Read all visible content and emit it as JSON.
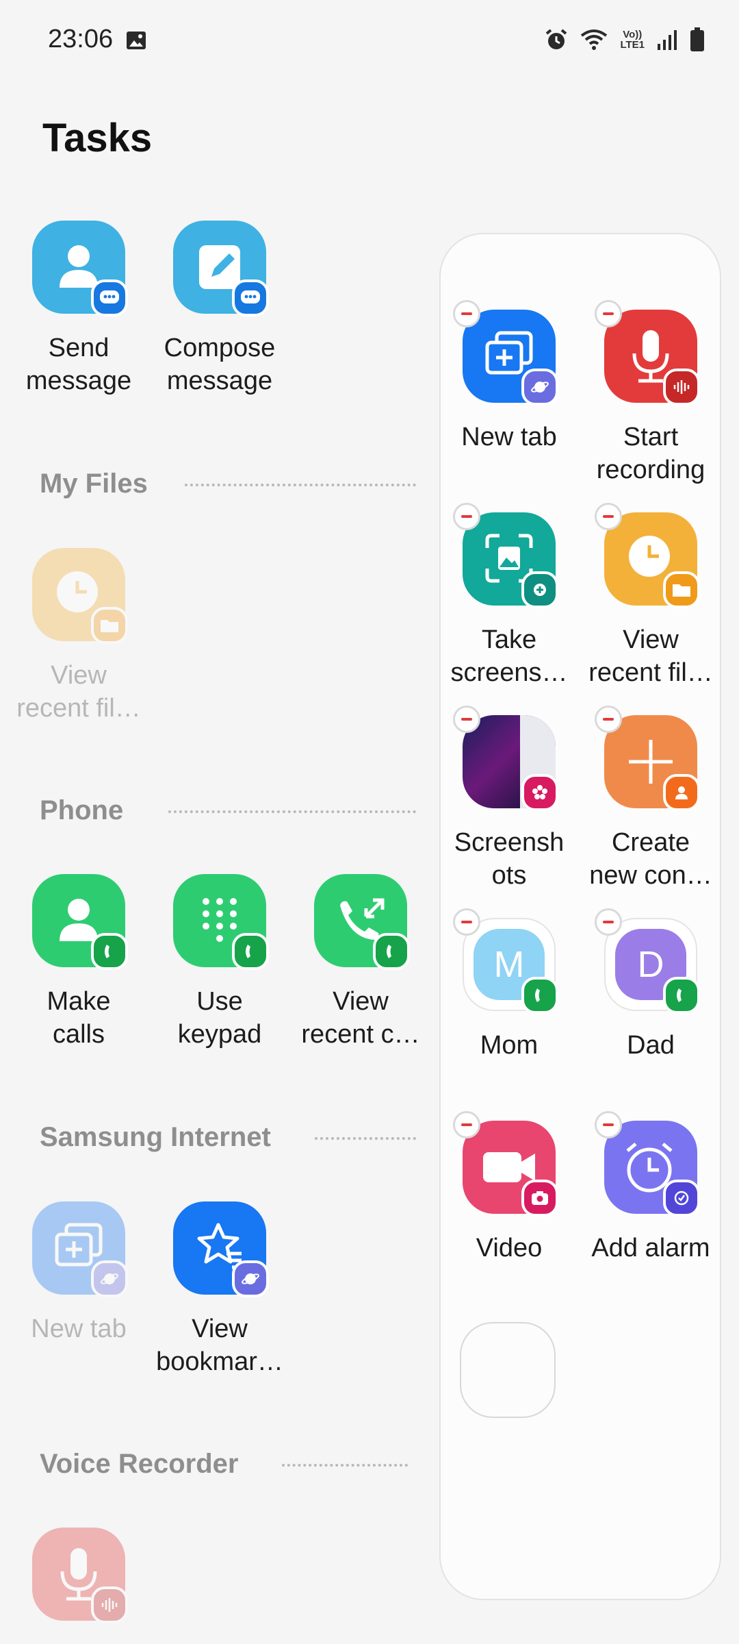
{
  "status_bar": {
    "time": "23:06",
    "network_label_top": "Vo))",
    "network_label_bottom": "LTE1",
    "icons": [
      "gallery-icon",
      "alarm-icon",
      "wifi-icon",
      "signal-icon",
      "battery-icon"
    ]
  },
  "page": {
    "title": "Tasks"
  },
  "sections": {
    "my_files": "My Files",
    "phone": "Phone",
    "samsung_internet": "Samsung Internet",
    "voice_recorder": "Voice Recorder"
  },
  "left": {
    "messages": [
      {
        "label": "Send\nmessage",
        "icon": "contact-icon"
      },
      {
        "label": "Compose\nmessage",
        "icon": "compose-icon"
      }
    ],
    "my_files": [
      {
        "label": "View\nrecent fil…",
        "icon": "clock-icon"
      }
    ],
    "phone": [
      {
        "label": "Make\ncalls",
        "icon": "contact-icon"
      },
      {
        "label": "Use\nkeypad",
        "icon": "keypad-icon"
      },
      {
        "label": "View\nrecent c…",
        "icon": "call-log-icon"
      }
    ],
    "samsung_internet": [
      {
        "label": "New tab",
        "icon": "new-tab-icon"
      },
      {
        "label": "View\nbookmar…",
        "icon": "bookmark-star-icon"
      }
    ],
    "voice_recorder": [
      {
        "label": "",
        "icon": "mic-icon"
      }
    ]
  },
  "panel": {
    "items": [
      {
        "label": "New tab"
      },
      {
        "label": "Start\nrecording"
      },
      {
        "label": "Take\nscreens…"
      },
      {
        "label": "View\nrecent fil…"
      },
      {
        "label": "Screensh\nots"
      },
      {
        "label": "Create\nnew con…"
      },
      {
        "label": "Mom",
        "initial": "M"
      },
      {
        "label": "Dad",
        "initial": "D"
      },
      {
        "label": "Video"
      },
      {
        "label": "Add alarm"
      }
    ]
  },
  "colors": {
    "messages_blue": "#3fb1e3",
    "phone_green": "#2ecc71",
    "internet_blue": "#1877f2",
    "internet_purple": "#6a6de0",
    "recorder_red": "#e33b3b",
    "files_orange": "#f3b13a",
    "screenshot_teal": "#12a89a",
    "contacts_orange": "#f08a4b",
    "video_pink": "#e8466f",
    "alarm_purple": "#7b74f0"
  }
}
